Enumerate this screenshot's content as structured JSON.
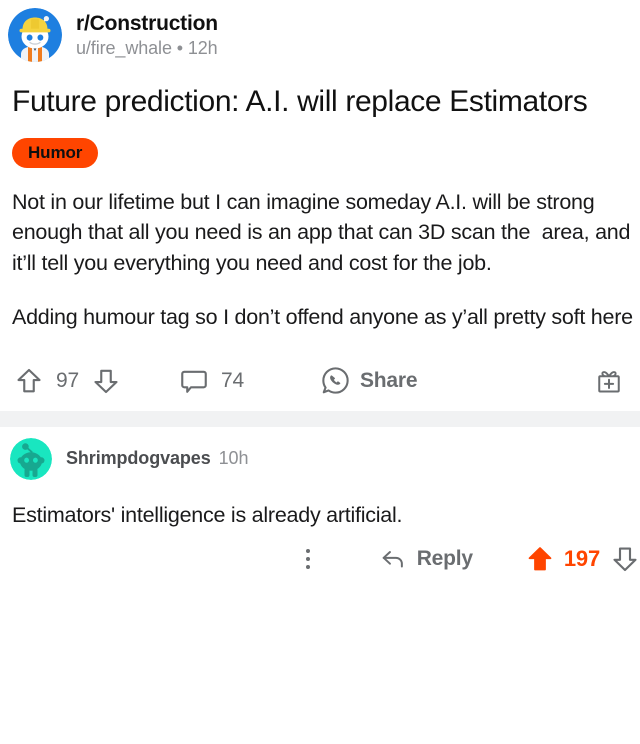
{
  "post": {
    "subreddit": "r/Construction",
    "author_line": "u/fire_whale • 12h",
    "avatar_icon": "snoo-hardhat-avatar",
    "title": "Future prediction: A.I. will replace Estimators",
    "flair": "Humor",
    "body_paragraphs": [
      "Not in our lifetime but I can imagine someday A.I. will be strong enough that all you need is an app that can 3D scan the  area, and it’ll tell you everything you need and cost for the job.",
      "Adding humour tag so I don’t offend anyone as y’all pretty soft here"
    ],
    "actions": {
      "upvote_icon": "upvote-arrow-icon",
      "score": "97",
      "downvote_icon": "downvote-arrow-icon",
      "comment_icon": "comment-bubble-icon",
      "comment_count": "74",
      "share_icon": "share-whatsapp-icon",
      "share_label": "Share",
      "award_icon": "gift-plus-icon"
    }
  },
  "comment": {
    "avatar_icon": "snoo-teal-avatar",
    "author": "Shrimpdogvapes",
    "timestamp": "10h",
    "text": "Estimators' intelligence is already artificial.",
    "actions": {
      "more_icon": "kebab-menu-icon",
      "reply_icon": "reply-arrow-icon",
      "reply_label": "Reply",
      "upvote_icon": "upvote-arrow-filled-icon",
      "score": "197",
      "downvote_icon": "downvote-arrow-icon"
    }
  },
  "colors": {
    "reddit_orange": "#ff4500",
    "muted_gray": "#6a6d70",
    "divider_gray": "#f1f2f3",
    "avatar_blue": "#1e7fe0",
    "hardhat_yellow": "#f5d33f",
    "comment_avatar_teal": "#19e6c0"
  }
}
